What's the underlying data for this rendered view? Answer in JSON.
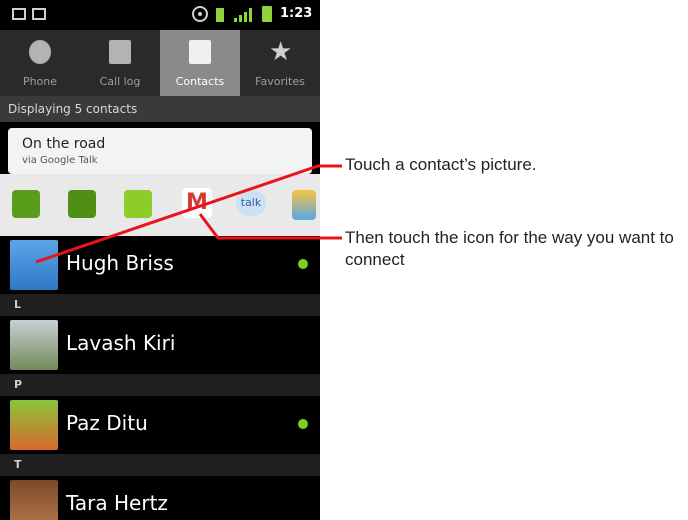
{
  "status_bar": {
    "time": "1:23"
  },
  "tabs": [
    {
      "label": "Phone",
      "icon": "phone-icon"
    },
    {
      "label": "Call log",
      "icon": "call-log-icon"
    },
    {
      "label": "Contacts",
      "icon": "contacts-icon",
      "active": true
    },
    {
      "label": "Favorites",
      "icon": "star-icon"
    }
  ],
  "contacts_count": "Displaying 5 contacts",
  "quick_contact": {
    "title": "On the road",
    "subtitle": "via Google Talk",
    "actions": [
      "call-icon",
      "tty-call-icon",
      "sms-icon",
      "gmail-icon",
      "talk-icon",
      "more-icon"
    ],
    "gmail_glyph": "M",
    "talk_glyph": "talk"
  },
  "list": {
    "rows": [
      {
        "name": "Hugh Briss",
        "online": true
      },
      {
        "separator": "L"
      },
      {
        "name": "Lavash Kiri",
        "online": false
      },
      {
        "separator": "P"
      },
      {
        "name": "Paz Ditu",
        "online": true
      },
      {
        "separator": "T"
      },
      {
        "name": "Tara Hertz",
        "online": false
      }
    ]
  },
  "callouts": {
    "picture": "Touch a contact’s picture.",
    "icon": "Then touch the icon for the way you want to connect"
  },
  "colors": {
    "callout_line": "#e8141c",
    "presence": "#7bd120"
  }
}
